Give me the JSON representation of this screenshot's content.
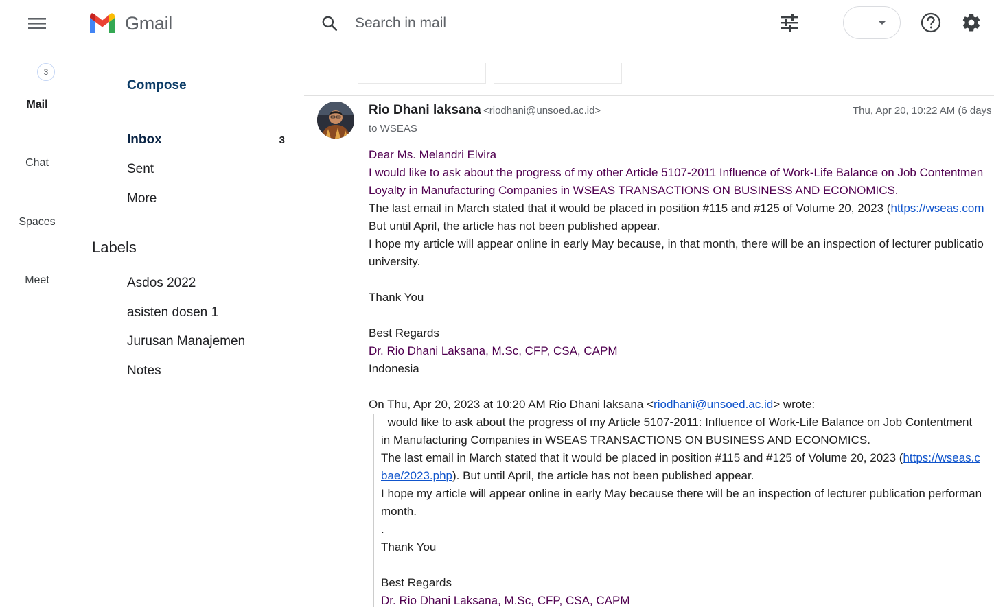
{
  "app": {
    "logo_text": "Gmail"
  },
  "header": {
    "search_placeholder": "Search in mail"
  },
  "rail": {
    "badge": "3",
    "items": [
      "Mail",
      "Chat",
      "Spaces",
      "Meet"
    ]
  },
  "sidebar": {
    "compose": "Compose",
    "nav": [
      {
        "label": "Inbox",
        "count": "3"
      },
      {
        "label": "Sent"
      },
      {
        "label": "More"
      }
    ],
    "labels_heading": "Labels",
    "labels": [
      "Asdos 2022",
      "asisten dosen 1",
      "Jurusan Manajemen",
      "Notes"
    ]
  },
  "message": {
    "sender_name": "Rio Dhani laksana",
    "sender_email": "<riodhani@unsoed.ac.id>",
    "date": "Thu, Apr 20, 10:22 AM (6 days",
    "to": "to WSEAS",
    "body": {
      "l1": "Dear Ms. Melandri Elvira",
      "l2": "I would like to ask about the progress of my other Article 5107-2011 Influence of Work-Life Balance on Job Contentmen",
      "l3": "Loyalty in Manufacturing Companies in WSEAS TRANSACTIONS ON BUSINESS AND ECONOMICS.",
      "l4_prefix": "The last email in March stated that it would be placed in position #115 and #125 of Volume 20, 2023 (",
      "l4_link": "https://wseas.com",
      "l5": "But until April, the article has not been published appear.",
      "l6": "I hope my article will appear online in early May because, in that month, there will be an inspection of lecturer publicatio",
      "l7": "university.",
      "l8": "Thank You",
      "l9": "Best Regards",
      "l10": "Dr. Rio Dhani Laksana, M.Sc, CFP, CSA, CAPM",
      "l11": "Indonesia",
      "quote_header_prefix": "On Thu, Apr 20, 2023 at 10:20 AM Rio Dhani laksana <",
      "quote_header_link": "riodhani@unsoed.ac.id",
      "quote_header_suffix": "> wrote:"
    },
    "quote": {
      "q1": "  would like to ask about the progress of my Article 5107-2011: Influence of Work-Life Balance on Job Contentment",
      "q2": "in Manufacturing Companies in WSEAS TRANSACTIONS ON BUSINESS AND ECONOMICS.",
      "q3_prefix": "The last email in March stated that it would be placed in position #115 and #125 of Volume 20, 2023 (",
      "q3_link": "https://wseas.c",
      "q4_link": "bae/2023.php",
      "q4_suffix": "). But until April, the article has not been published appear.",
      "q5": "I hope my article will appear online in early May because there will be an inspection of lecturer publication performan",
      "q6": "month.",
      "q7": ".",
      "q8": "Thank You",
      "q9": "Best Regards",
      "q10": "Dr. Rio Dhani Laksana, M.Sc, CFP, CSA, CAPM"
    }
  },
  "colors": {
    "accent_purple": "#500050",
    "link_blue": "#1155cc",
    "compose_blue": "#0b3b66"
  }
}
